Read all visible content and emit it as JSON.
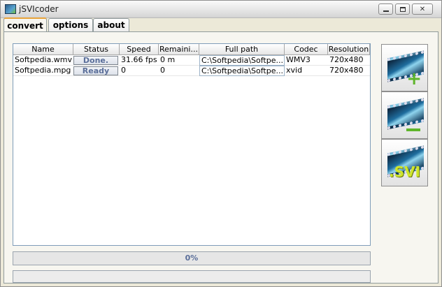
{
  "window": {
    "title": "jSVIcoder"
  },
  "tabs": [
    {
      "label": "convert",
      "active": true
    },
    {
      "label": "options",
      "active": false
    },
    {
      "label": "about",
      "active": false
    }
  ],
  "table": {
    "columns": [
      "Name",
      "Status",
      "Speed",
      "Remaini...",
      "Full path",
      "Codec",
      "Resolution"
    ],
    "rows": [
      {
        "name": "Softpedia.wmv",
        "status": "Done.",
        "speed": "31.66 fps",
        "remaining": "0 m",
        "path": "C:\\Softpedia\\Softpe...",
        "codec": "WMV3",
        "resolution": "720x480"
      },
      {
        "name": "Softpedia.mpg",
        "status": "Ready",
        "speed": "0",
        "remaining": "0",
        "path": "C:\\Softpedia\\Softpe...",
        "codec": "xvid",
        "resolution": "720x480"
      }
    ]
  },
  "progress": {
    "label": "0%",
    "value": 0
  },
  "side_buttons": {
    "add_icon": "add-video-icon",
    "remove_icon": "remove-video-icon",
    "svi_text": ".SVI"
  },
  "colors": {
    "accent_tab": "#e8a33a",
    "status_text": "#5b6f9a"
  }
}
